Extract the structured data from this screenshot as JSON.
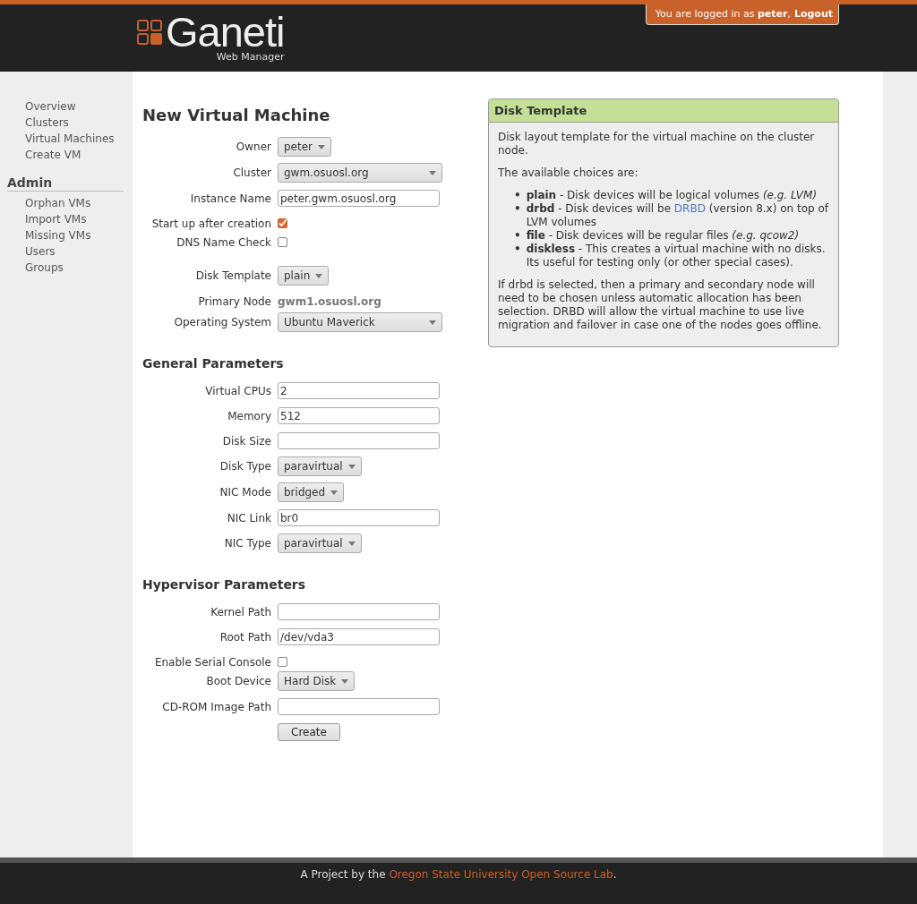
{
  "header": {
    "logo_text": "Ganeti",
    "logo_subtitle": "Web Manager",
    "login": {
      "prefix": "You are logged in as",
      "user": "peter",
      "separator": ",",
      "logout": "Logout"
    }
  },
  "sidebar": {
    "items": [
      {
        "label": "Overview"
      },
      {
        "label": "Clusters"
      },
      {
        "label": "Virtual Machines"
      },
      {
        "label": "Create VM"
      }
    ],
    "sections": [
      {
        "title": "Admin",
        "items": [
          {
            "label": "Orphan VMs"
          },
          {
            "label": "Import VMs"
          },
          {
            "label": "Missing VMs"
          },
          {
            "label": "Users"
          },
          {
            "label": "Groups"
          }
        ]
      }
    ]
  },
  "form": {
    "title": "New Virtual Machine",
    "sections": [
      {
        "rows": [
          {
            "kind": "select",
            "label": "Owner",
            "value": "peter",
            "wide": false
          },
          {
            "kind": "select",
            "label": "Cluster",
            "value": "gwm.osuosl.org",
            "wide": true
          },
          {
            "kind": "text",
            "label": "Instance Name",
            "value": "peter.gwm.osuosl.org"
          },
          {
            "kind": "checkbox",
            "label": "Start up after creation",
            "checked": true
          },
          {
            "kind": "checkbox",
            "label": "DNS Name Check",
            "checked": false
          },
          {
            "kind": "gap"
          },
          {
            "kind": "select",
            "label": "Disk Template",
            "value": "plain",
            "wide": false
          },
          {
            "kind": "static",
            "label": "Primary Node",
            "value": "gwm1.osuosl.org"
          },
          {
            "kind": "select",
            "label": "Operating System",
            "value": "Ubuntu Maverick",
            "wide": true
          }
        ]
      },
      {
        "title": "General Parameters",
        "rows": [
          {
            "kind": "text",
            "label": "Virtual CPUs",
            "value": "2"
          },
          {
            "kind": "text",
            "label": "Memory",
            "value": "512"
          },
          {
            "kind": "text",
            "label": "Disk Size",
            "value": ""
          },
          {
            "kind": "select",
            "label": "Disk Type",
            "value": "paravirtual",
            "wide": false
          },
          {
            "kind": "select",
            "label": "NIC Mode",
            "value": "bridged",
            "wide": false
          },
          {
            "kind": "text",
            "label": "NIC Link",
            "value": "br0"
          },
          {
            "kind": "select",
            "label": "NIC Type",
            "value": "paravirtual",
            "wide": false
          }
        ]
      },
      {
        "title": "Hypervisor Parameters",
        "rows": [
          {
            "kind": "text",
            "label": "Kernel Path",
            "value": ""
          },
          {
            "kind": "text",
            "label": "Root Path",
            "value": "/dev/vda3"
          },
          {
            "kind": "checkbox",
            "label": "Enable Serial Console",
            "checked": false
          },
          {
            "kind": "select",
            "label": "Boot Device",
            "value": "Hard Disk",
            "wide": false
          },
          {
            "kind": "text",
            "label": "CD-ROM Image Path",
            "value": ""
          }
        ]
      }
    ],
    "submit": "Create"
  },
  "help": {
    "title": "Disk Template",
    "intro": "Disk layout template for the virtual machine on the cluster node.",
    "lead": "The available choices are:",
    "items": [
      {
        "marker": "•",
        "segments": [
          {
            "kind": "text",
            "text": "**plain** - Disk devices will be logical volumes *(e.g. LVM)*"
          }
        ]
      },
      {
        "marker": "•",
        "segments": [
          {
            "kind": "text",
            "text": "**drbd** - Disk devices will be "
          },
          {
            "kind": "link",
            "text": "DRBD"
          },
          {
            "kind": "text",
            "text": " (version 8.x) on top of LVM volumes"
          }
        ]
      },
      {
        "marker": "•",
        "segments": [
          {
            "kind": "text",
            "text": "**file** - Disk devices will be regular files *(e.g. qcow2)*"
          }
        ]
      },
      {
        "marker": "•",
        "segments": [
          {
            "kind": "text",
            "text": "**diskless** - This creates a virtual machine with no disks. Its useful for testing only (or other special cases)."
          }
        ]
      }
    ],
    "outro": "If drbd is selected, then a primary and secondary node will need to be chosen unless automatic allocation has been selection. DRBD will allow the virtual machine to use live migration and failover in case one of the nodes goes offline."
  },
  "footer": {
    "prefix": "A Project by the",
    "link": "Oregon State University Open Source Lab",
    "suffix": "."
  }
}
